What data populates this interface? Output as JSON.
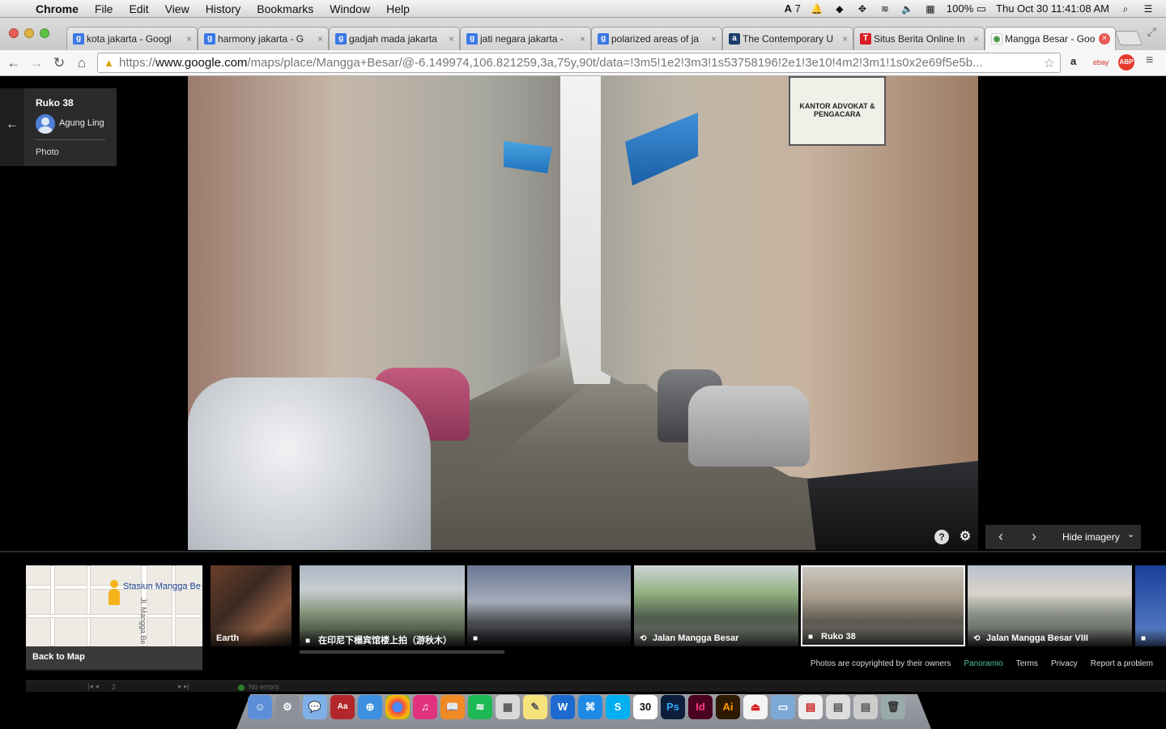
{
  "menubar": {
    "app": "Chrome",
    "menus": [
      "File",
      "Edit",
      "View",
      "History",
      "Bookmarks",
      "Window",
      "Help"
    ],
    "adobe_count": "7",
    "battery": "100%",
    "datetime": "Thu Oct 30  11:41:08 AM"
  },
  "tabs": [
    {
      "title": "kota jakarta - Googl",
      "fav": "g"
    },
    {
      "title": "harmony jakarta - G",
      "fav": "g"
    },
    {
      "title": "gadjah mada jakarta",
      "fav": "g"
    },
    {
      "title": "jati negara jakarta -",
      "fav": "g"
    },
    {
      "title": "polarized areas of ja",
      "fav": "g"
    },
    {
      "title": "The Contemporary U",
      "fav": "a"
    },
    {
      "title": "Situs Berita Online In",
      "fav": "t"
    },
    {
      "title": "Mangga Besar - Goo",
      "fav": "m",
      "active": true
    }
  ],
  "omnibox": {
    "scheme": "https://",
    "host": "www.google.com",
    "path": "/maps/place/Mangga+Besar/@-6.149974,106.821259,3a,75y,90t/data=!3m5!1e2!3m3!1s53758196!2e1!3e10!4m2!3m1!1s0x2e69f5e5b..."
  },
  "extensions": {
    "amazon": "a",
    "ebay": "ebay",
    "abp": "ABP"
  },
  "infocard": {
    "place": "Ruko 38",
    "author": "Agung Ling",
    "kind": "Photo"
  },
  "photo": {
    "sign_text": "KANTOR ADVOKAT & PENGACARA"
  },
  "pager": {
    "hide_label": "Hide imagery"
  },
  "filmstrip": {
    "map": {
      "station": "Stasiun Mangga Be",
      "street": "Jl. Mangga Be",
      "back_label": "Back to Map"
    },
    "earth_label": "Earth",
    "items": [
      {
        "label": "在印尼下榻宾馆楼上拍（游秋木）",
        "icon": "camera-icon"
      },
      {
        "label": "",
        "icon": "camera-icon"
      },
      {
        "label": "Jalan Mangga Besar",
        "icon": "streetview-icon"
      },
      {
        "label": "Ruko 38",
        "icon": "camera-icon"
      },
      {
        "label": "Jalan Mangga Besar VIII",
        "icon": "streetview-icon"
      },
      {
        "label": "",
        "icon": "camera-icon"
      }
    ]
  },
  "footer": {
    "copyright": "Photos are copyrighted by their owners",
    "panoramio": "Panoramio",
    "terms": "Terms",
    "privacy": "Privacy",
    "report": "Report a problem"
  },
  "devbar": {
    "page": "2",
    "status": "No errors"
  },
  "dock": {
    "calendar_day": "30",
    "ps": "Ps",
    "id": "Id",
    "ai": "Ai"
  }
}
